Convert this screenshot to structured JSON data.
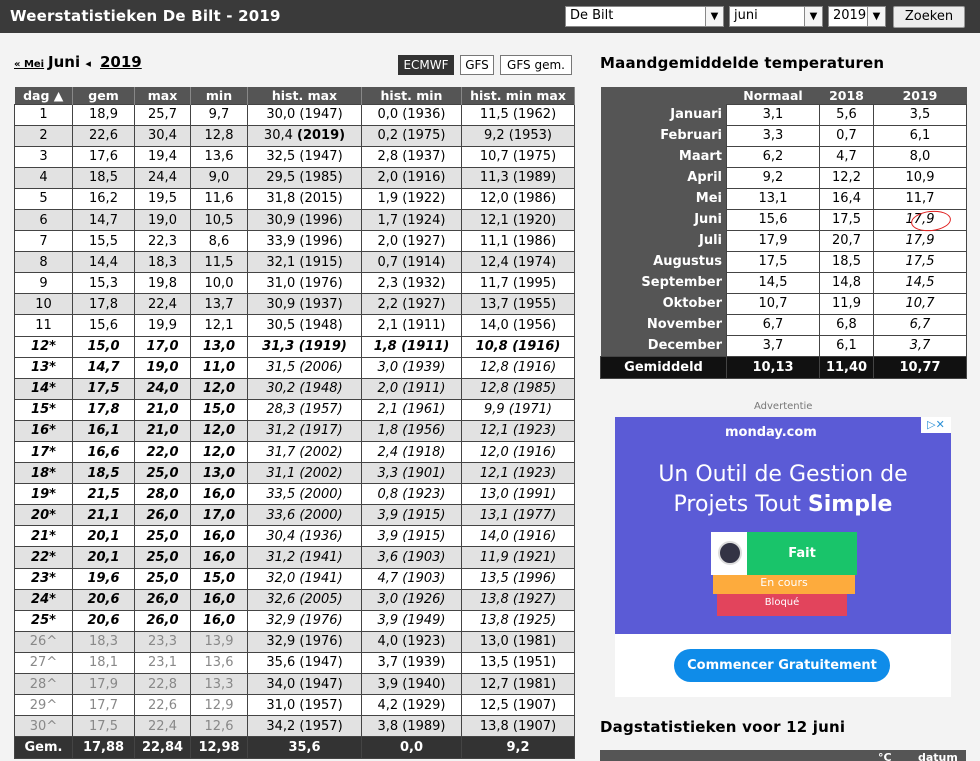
{
  "app": {
    "title": "Weerstatistieken De Bilt - 2019"
  },
  "filters": {
    "station": "De Bilt",
    "month": "juni",
    "year": "2019",
    "search_label": "Zoeken"
  },
  "nav": {
    "prev": "« Mei",
    "month": "Juni",
    "arrow": "◂",
    "year": "2019"
  },
  "models": [
    "ECMWF",
    "GFS",
    "GFS gem."
  ],
  "daytable": {
    "headers": [
      "dag ▲",
      "gem",
      "max",
      "min",
      "hist. max",
      "hist. min",
      "hist. min max"
    ],
    "rows": [
      {
        "dag": "1",
        "gem": "18,9",
        "max": "25,7",
        "min": "9,7",
        "hmax": "30,0 (1947)",
        "hmin": "0,0 (1936)",
        "hmm": "11,5 (1962)"
      },
      {
        "dag": "2",
        "gem": "22,6",
        "max": "30,4",
        "min": "12,8",
        "hmax": "30,4 (2019)",
        "hmin": "0,2 (1975)",
        "hmm": "9,2 (1953)"
      },
      {
        "dag": "3",
        "gem": "17,6",
        "max": "19,4",
        "min": "13,6",
        "hmax": "32,5 (1947)",
        "hmin": "2,8 (1937)",
        "hmm": "10,7 (1975)"
      },
      {
        "dag": "4",
        "gem": "18,5",
        "max": "24,4",
        "min": "9,0",
        "hmax": "29,5 (1985)",
        "hmin": "2,0 (1916)",
        "hmm": "11,3 (1989)"
      },
      {
        "dag": "5",
        "gem": "16,2",
        "max": "19,5",
        "min": "11,6",
        "hmax": "31,8 (2015)",
        "hmin": "1,9 (1922)",
        "hmm": "12,0 (1986)"
      },
      {
        "dag": "6",
        "gem": "14,7",
        "max": "19,0",
        "min": "10,5",
        "hmax": "30,9 (1996)",
        "hmin": "1,7 (1924)",
        "hmm": "12,1 (1920)"
      },
      {
        "dag": "7",
        "gem": "15,5",
        "max": "22,3",
        "min": "8,6",
        "hmax": "33,9 (1996)",
        "hmin": "2,0 (1927)",
        "hmm": "11,1 (1986)"
      },
      {
        "dag": "8",
        "gem": "14,4",
        "max": "18,3",
        "min": "11,5",
        "hmax": "32,1 (1915)",
        "hmin": "0,7 (1914)",
        "hmm": "12,4 (1974)"
      },
      {
        "dag": "9",
        "gem": "15,3",
        "max": "19,8",
        "min": "10,0",
        "hmax": "31,0 (1976)",
        "hmin": "2,3 (1932)",
        "hmm": "11,7 (1995)"
      },
      {
        "dag": "10",
        "gem": "17,8",
        "max": "22,4",
        "min": "13,7",
        "hmax": "30,9 (1937)",
        "hmin": "2,2 (1927)",
        "hmm": "13,7 (1955)"
      },
      {
        "dag": "11",
        "gem": "15,6",
        "max": "19,9",
        "min": "12,1",
        "hmax": "30,5 (1948)",
        "hmin": "2,1 (1911)",
        "hmm": "14,0 (1956)"
      },
      {
        "dag": "12*",
        "gem": "15,0",
        "max": "17,0",
        "min": "13,0",
        "hmax": "31,3 (1919)",
        "hmin": "1,8 (1911)",
        "hmm": "10,8 (1916)"
      },
      {
        "dag": "13*",
        "gem": "14,7",
        "max": "19,0",
        "min": "11,0",
        "hmax": "31,5 (2006)",
        "hmin": "3,0 (1939)",
        "hmm": "12,8 (1916)"
      },
      {
        "dag": "14*",
        "gem": "17,5",
        "max": "24,0",
        "min": "12,0",
        "hmax": "30,2 (1948)",
        "hmin": "2,0 (1911)",
        "hmm": "12,8 (1985)"
      },
      {
        "dag": "15*",
        "gem": "17,8",
        "max": "21,0",
        "min": "15,0",
        "hmax": "28,3 (1957)",
        "hmin": "2,1 (1961)",
        "hmm": "9,9 (1971)"
      },
      {
        "dag": "16*",
        "gem": "16,1",
        "max": "21,0",
        "min": "12,0",
        "hmax": "31,2 (1917)",
        "hmin": "1,8 (1956)",
        "hmm": "12,1 (1923)"
      },
      {
        "dag": "17*",
        "gem": "16,6",
        "max": "22,0",
        "min": "12,0",
        "hmax": "31,7 (2002)",
        "hmin": "2,4 (1918)",
        "hmm": "12,0 (1916)"
      },
      {
        "dag": "18*",
        "gem": "18,5",
        "max": "25,0",
        "min": "13,0",
        "hmax": "31,1 (2002)",
        "hmin": "3,3 (1901)",
        "hmm": "12,1 (1923)"
      },
      {
        "dag": "19*",
        "gem": "21,5",
        "max": "28,0",
        "min": "16,0",
        "hmax": "33,5 (2000)",
        "hmin": "0,8 (1923)",
        "hmm": "13,0 (1991)"
      },
      {
        "dag": "20*",
        "gem": "21,1",
        "max": "26,0",
        "min": "17,0",
        "hmax": "33,6 (2000)",
        "hmin": "3,9 (1915)",
        "hmm": "13,1 (1977)"
      },
      {
        "dag": "21*",
        "gem": "20,1",
        "max": "25,0",
        "min": "16,0",
        "hmax": "30,4 (1936)",
        "hmin": "3,9 (1915)",
        "hmm": "14,0 (1916)"
      },
      {
        "dag": "22*",
        "gem": "20,1",
        "max": "25,0",
        "min": "16,0",
        "hmax": "31,2 (1941)",
        "hmin": "3,6 (1903)",
        "hmm": "11,9 (1921)"
      },
      {
        "dag": "23*",
        "gem": "19,6",
        "max": "25,0",
        "min": "15,0",
        "hmax": "32,0 (1941)",
        "hmin": "4,7 (1903)",
        "hmm": "13,5 (1996)"
      },
      {
        "dag": "24*",
        "gem": "20,6",
        "max": "26,0",
        "min": "16,0",
        "hmax": "32,6 (2005)",
        "hmin": "3,0 (1926)",
        "hmm": "13,8 (1927)"
      },
      {
        "dag": "25*",
        "gem": "20,6",
        "max": "26,0",
        "min": "16,0",
        "hmax": "32,9 (1976)",
        "hmin": "3,9 (1949)",
        "hmm": "13,8 (1925)"
      },
      {
        "dag": "26^",
        "gem": "18,3",
        "max": "23,3",
        "min": "13,9",
        "hmax": "32,9 (1976)",
        "hmin": "4,0 (1923)",
        "hmm": "13,0 (1981)"
      },
      {
        "dag": "27^",
        "gem": "18,1",
        "max": "23,1",
        "min": "13,6",
        "hmax": "35,6 (1947)",
        "hmin": "3,7 (1939)",
        "hmm": "13,5 (1951)"
      },
      {
        "dag": "28^",
        "gem": "17,9",
        "max": "22,8",
        "min": "13,3",
        "hmax": "34,0 (1947)",
        "hmin": "3,9 (1940)",
        "hmm": "12,7 (1981)"
      },
      {
        "dag": "29^",
        "gem": "17,7",
        "max": "22,6",
        "min": "12,9",
        "hmax": "31,0 (1957)",
        "hmin": "4,2 (1929)",
        "hmm": "12,5 (1907)"
      },
      {
        "dag": "30^",
        "gem": "17,5",
        "max": "22,4",
        "min": "12,6",
        "hmax": "34,2 (1957)",
        "hmin": "3,8 (1989)",
        "hmm": "13,8 (1907)"
      }
    ],
    "footer": {
      "label": "Gem.",
      "gem": "17,88",
      "max": "22,84",
      "min": "12,98",
      "hmax": "35,6",
      "hmin": "0,0",
      "hmm": "9,2"
    }
  },
  "monthly": {
    "title": "Maandgemiddelde temperaturen",
    "headers": [
      "Normaal",
      "2018",
      "2019"
    ],
    "rows": [
      {
        "m": "Januari",
        "n": "3,1",
        "a": "5,6",
        "b": "3,5"
      },
      {
        "m": "Februari",
        "n": "3,3",
        "a": "0,7",
        "b": "6,1"
      },
      {
        "m": "Maart",
        "n": "6,2",
        "a": "4,7",
        "b": "8,0"
      },
      {
        "m": "April",
        "n": "9,2",
        "a": "12,2",
        "b": "10,9"
      },
      {
        "m": "Mei",
        "n": "13,1",
        "a": "16,4",
        "b": "11,7"
      },
      {
        "m": "Juni",
        "n": "15,6",
        "a": "17,5",
        "b": "17,9"
      },
      {
        "m": "Juli",
        "n": "17,9",
        "a": "20,7",
        "b": "17,9"
      },
      {
        "m": "Augustus",
        "n": "17,5",
        "a": "18,5",
        "b": "17,5"
      },
      {
        "m": "September",
        "n": "14,5",
        "a": "14,8",
        "b": "14,5"
      },
      {
        "m": "Oktober",
        "n": "10,7",
        "a": "11,9",
        "b": "10,7"
      },
      {
        "m": "November",
        "n": "6,7",
        "a": "6,8",
        "b": "6,7"
      },
      {
        "m": "December",
        "n": "3,7",
        "a": "6,1",
        "b": "3,7"
      }
    ],
    "footer": {
      "label": "Gemiddeld",
      "n": "10,13",
      "a": "11,40",
      "b": "10,77"
    }
  },
  "ad": {
    "label": "Advertentie",
    "brand": "monday.com",
    "line1": "Un Outil de Gestion de",
    "line2_pre": "Projets Tout ",
    "line2_bold": "Simple",
    "card1": "Fait",
    "card2": "En cours",
    "card3": "Bloqué",
    "cta": "Commencer Gratuitement"
  },
  "daystats": {
    "title": "Dagstatistieken voor 12 juni",
    "h1": "°C",
    "h2": "datum"
  }
}
